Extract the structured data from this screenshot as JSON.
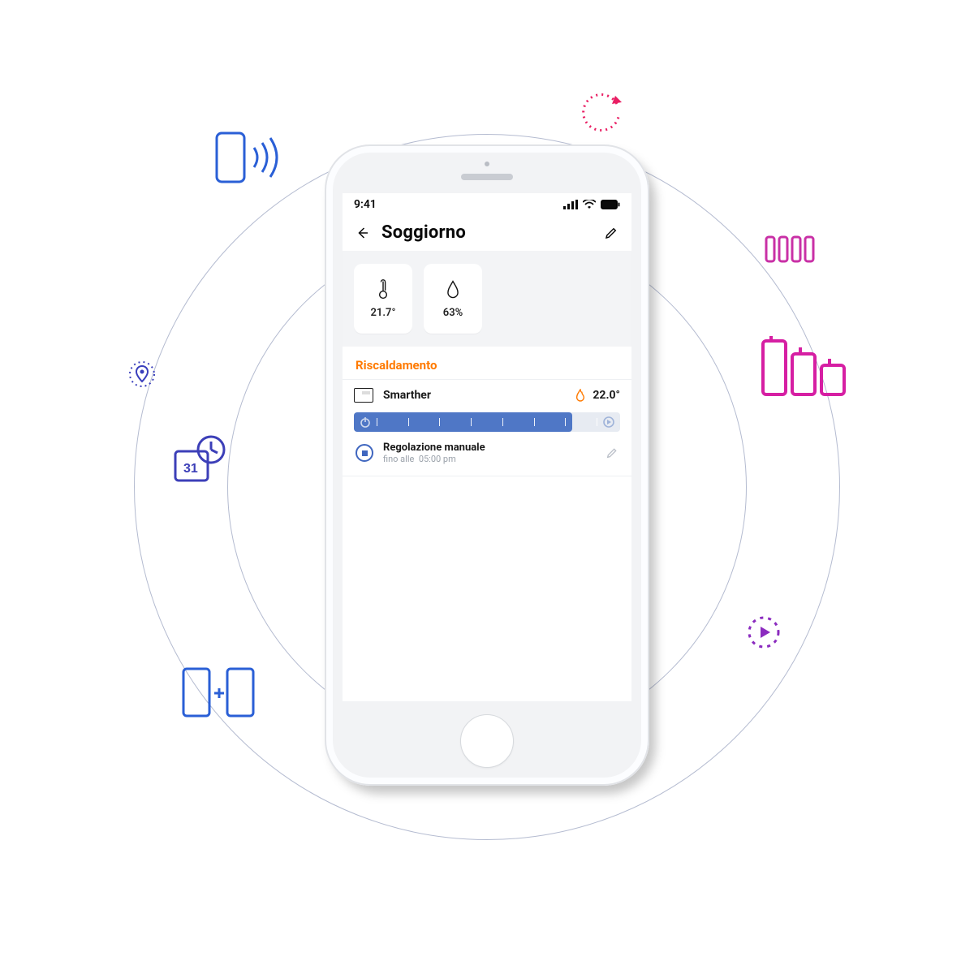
{
  "statusbar": {
    "time": "9:41"
  },
  "header": {
    "title": "Soggiorno"
  },
  "metrics": {
    "temperature": "21.7°",
    "humidity": "63%"
  },
  "section": {
    "heating_label": "Riscaldamento"
  },
  "device": {
    "name": "Smarther",
    "set_temp": "22.0°",
    "mode_title": "Regolazione manuale",
    "mode_until_prefix": "fino alle",
    "mode_until_time": "05:00 pm"
  },
  "colors": {
    "accent_orange": "#ff7a00",
    "slider_blue": "#4f77c6"
  },
  "orbit_icons": [
    "phone-broadcast-icon",
    "refresh-icon",
    "radiator-icon",
    "bars-chart-icon",
    "play-ring-icon",
    "add-device-icon",
    "calendar-clock-icon",
    "location-target-icon"
  ]
}
